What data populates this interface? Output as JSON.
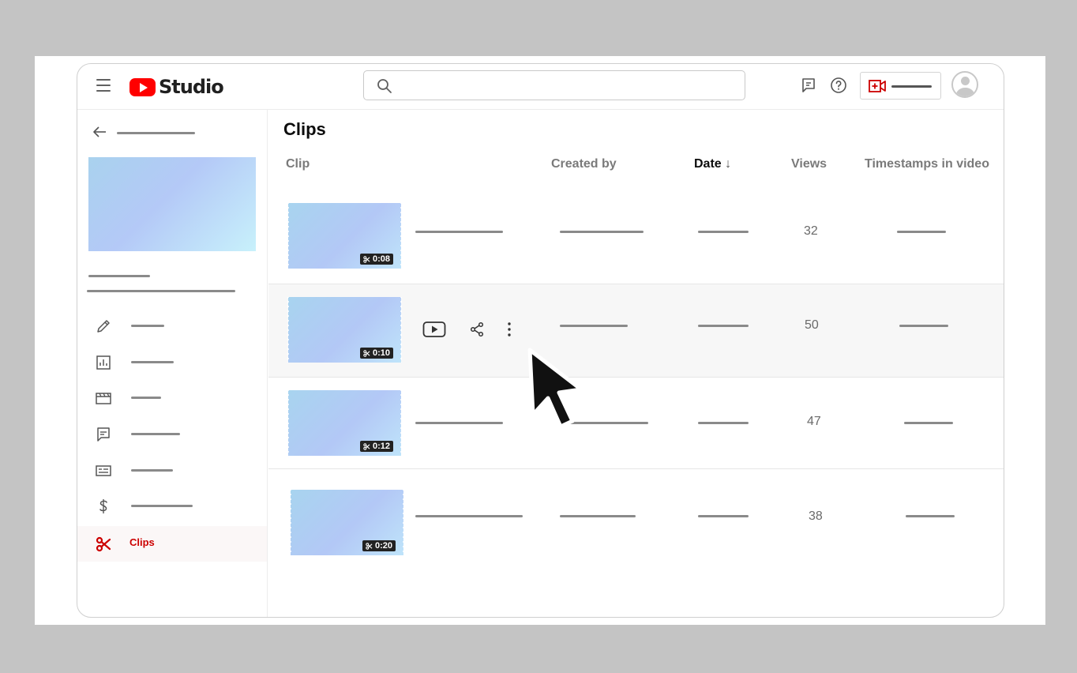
{
  "app": {
    "logo_text": "Studio"
  },
  "header": {
    "search_placeholder": "",
    "icons": [
      "menu-icon",
      "search-icon",
      "feedback-icon",
      "help-icon",
      "create-icon",
      "avatar"
    ]
  },
  "sidebar": {
    "active_item": "Clips",
    "items": [
      {
        "icon": "pencil-icon",
        "label": ""
      },
      {
        "icon": "analytics-icon",
        "label": ""
      },
      {
        "icon": "editor-icon",
        "label": ""
      },
      {
        "icon": "comments-icon",
        "label": ""
      },
      {
        "icon": "subtitles-icon",
        "label": ""
      },
      {
        "icon": "dollar-icon",
        "label": ""
      },
      {
        "icon": "scissors-icon",
        "label": "Clips"
      }
    ]
  },
  "main": {
    "title": "Clips",
    "columns": [
      "Clip",
      "Created by",
      "Date",
      "Views",
      "Timestamps in video"
    ],
    "sort_indicator": "↓",
    "rows": [
      {
        "duration": "0:08",
        "views": "32"
      },
      {
        "duration": "0:10",
        "views": "50"
      },
      {
        "duration": "0:12",
        "views": "47"
      },
      {
        "duration": "0:20",
        "views": "38"
      }
    ]
  },
  "colors": {
    "brand_red": "#ff0000",
    "active_red": "#cc0000"
  }
}
